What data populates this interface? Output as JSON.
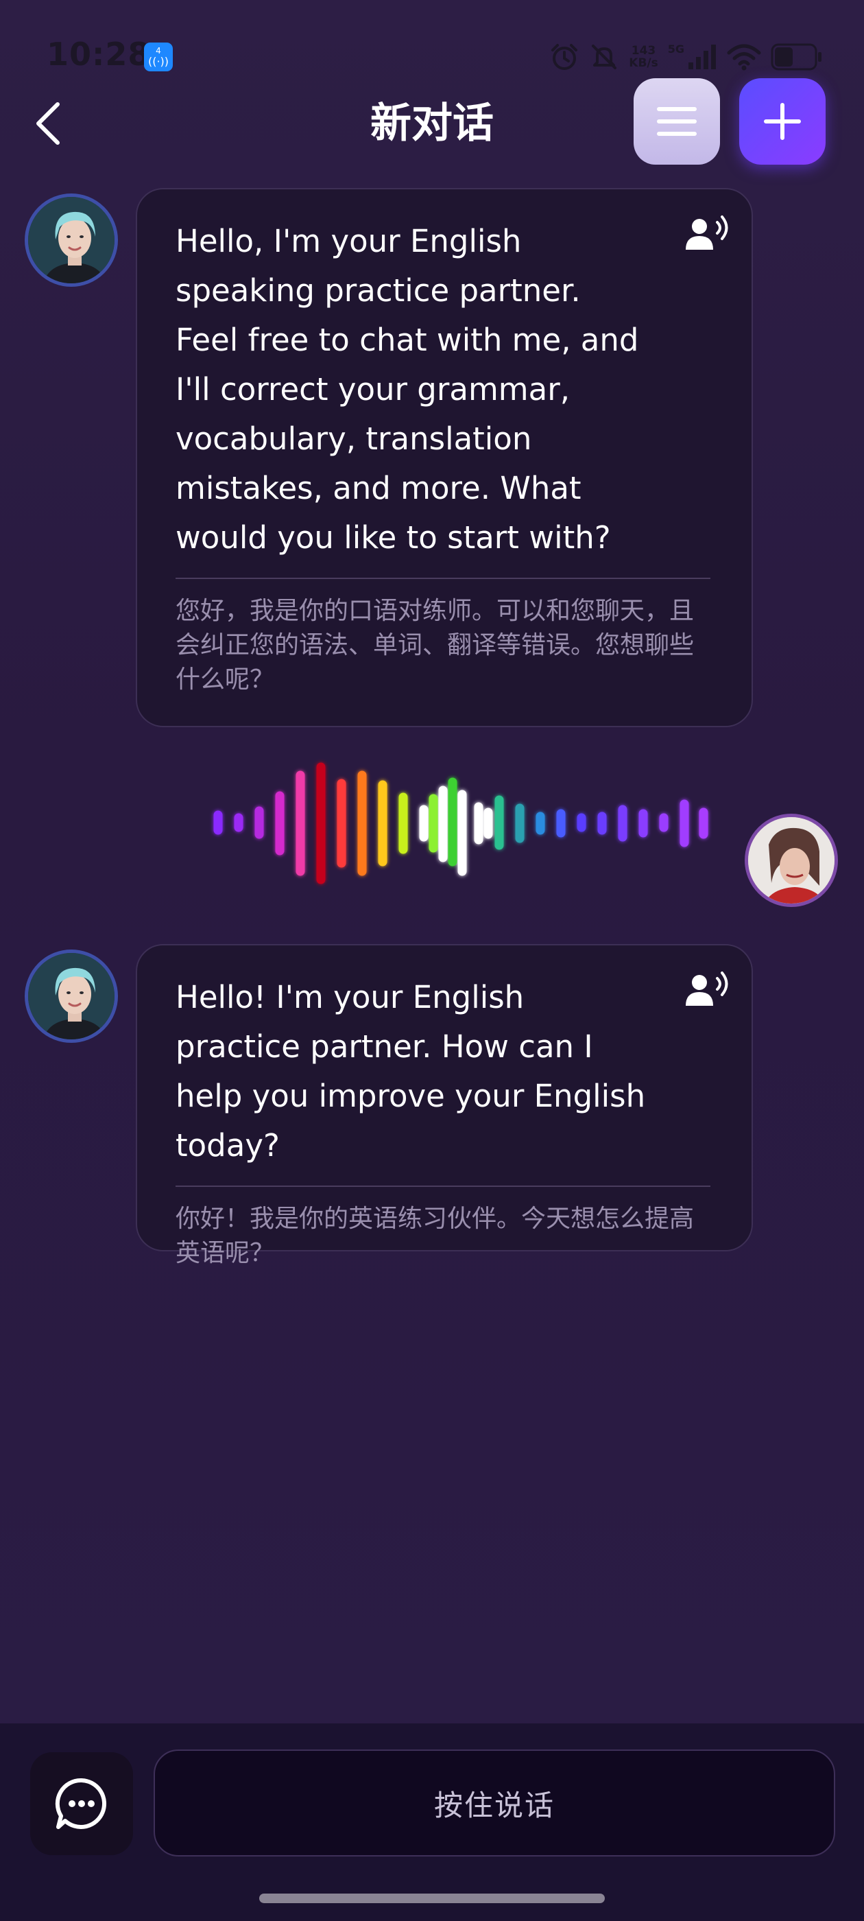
{
  "status_bar": {
    "time": "10:28",
    "hotspot_badge_top": "4",
    "network_speed_value": "143",
    "network_speed_unit": "KB/s",
    "signal_label": "5G",
    "icons": [
      "alarm-icon",
      "mute-icon",
      "signal-icon",
      "wifi-icon",
      "battery-icon"
    ]
  },
  "header": {
    "title": "新对话",
    "back_icon": "chevron-left-icon",
    "menu_icon": "menu-icon",
    "add_icon": "plus-icon"
  },
  "messages": [
    {
      "sender": "assistant",
      "en": "Hello, I'm your English speaking practice partner. Feel free to chat with me, and I'll correct your grammar, vocabulary, translation mistakes, and more. What would you like to start with?",
      "zh": "您好，我是你的口语对练师。可以和您聊天，且会纠正您的语法、单词、翻译等错误。您想聊些什么呢？"
    },
    {
      "sender": "user",
      "type": "voice"
    },
    {
      "sender": "assistant",
      "en": "Hello! I'm your English practice partner. How can I help you improve your English today?",
      "zh": "你好！我是你的英语练习伙伴。今天想怎么提高英语呢？"
    }
  ],
  "bottom_bar": {
    "chat_mode_icon": "chat-bubble-icon",
    "talk_button_label": "按住说话"
  },
  "colors": {
    "background": "#2a1c42",
    "bubble": "#1f1530",
    "accent": "#6a45ff",
    "menu_button": "#cfc5ee"
  }
}
